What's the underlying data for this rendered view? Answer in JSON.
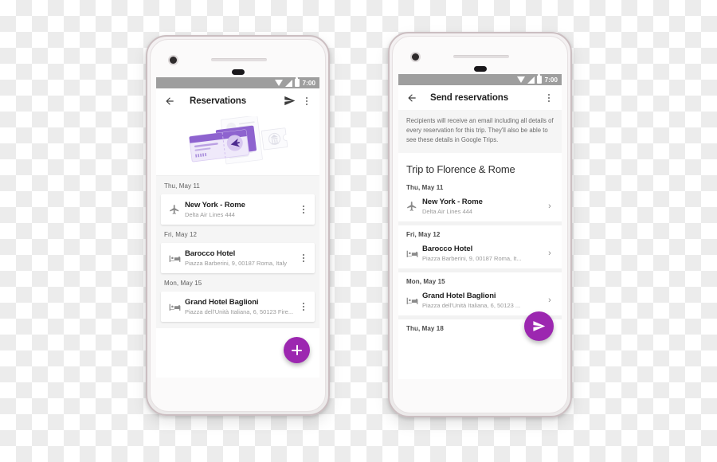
{
  "scene": {
    "description": "Two Android phone mockups side by side showing Google Trips reservation screens",
    "accent_color": "#9c27b0",
    "statusbar_color": "#9e9e9e",
    "page_background": "transparent-checkerboard"
  },
  "status_bar": {
    "time": "7:00",
    "icons": [
      "wifi-icon",
      "signal-icon",
      "battery-icon"
    ]
  },
  "left_phone": {
    "toolbar": {
      "back_icon": "back-arrow-icon",
      "title": "Reservations",
      "send_icon": "send-icon",
      "overflow_icon": "more-vert-icon"
    },
    "hero": {
      "illustration": "boarding-pass-illustration"
    },
    "sections": [
      {
        "date": "Thu, May 11",
        "item": {
          "icon": "flight-icon",
          "title": "New York - Rome",
          "subtitle": "Delta Air Lines 444",
          "action_icon": "more-vert-icon"
        }
      },
      {
        "date": "Fri, May 12",
        "item": {
          "icon": "hotel-icon",
          "title": "Barocco Hotel",
          "subtitle": "Piazza Barberini, 9, 00187 Roma, Italy",
          "action_icon": "more-vert-icon"
        }
      },
      {
        "date": "Mon, May 15",
        "item": {
          "icon": "hotel-icon",
          "title": "Grand Hotel Baglioni",
          "subtitle": "Piazza dell'Unità Italiana, 6, 50123 Fire...",
          "action_icon": "more-vert-icon"
        }
      }
    ],
    "fab": {
      "icon": "plus-icon",
      "color": "#9c27b0"
    }
  },
  "right_phone": {
    "toolbar": {
      "back_icon": "back-arrow-icon",
      "title": "Send reservations",
      "overflow_icon": "more-vert-icon"
    },
    "notice": "Recipients will receive an email including all details of every reservation for this trip. They'll also be able to see these details in Google Trips.",
    "trip_title": "Trip to Florence & Rome",
    "sections": [
      {
        "date": "Thu, May 11",
        "item": {
          "icon": "flight-icon",
          "title": "New York - Rome",
          "subtitle": "Delta Air Lines 444",
          "action_icon": "chevron-right-icon"
        }
      },
      {
        "date": "Fri, May 12",
        "item": {
          "icon": "hotel-icon",
          "title": "Barocco Hotel",
          "subtitle": "Piazza Barberini, 9, 00187 Roma, It...",
          "action_icon": "chevron-right-icon"
        }
      },
      {
        "date": "Mon, May 15",
        "item": {
          "icon": "hotel-icon",
          "title": "Grand Hotel Baglioni",
          "subtitle": "Piazza dell'Unità Italiana, 6, 50123 ...",
          "action_icon": "chevron-right-icon"
        }
      },
      {
        "date": "Thu, May 18",
        "item": null
      }
    ],
    "fab": {
      "icon": "send-icon",
      "color": "#9c27b0"
    }
  }
}
